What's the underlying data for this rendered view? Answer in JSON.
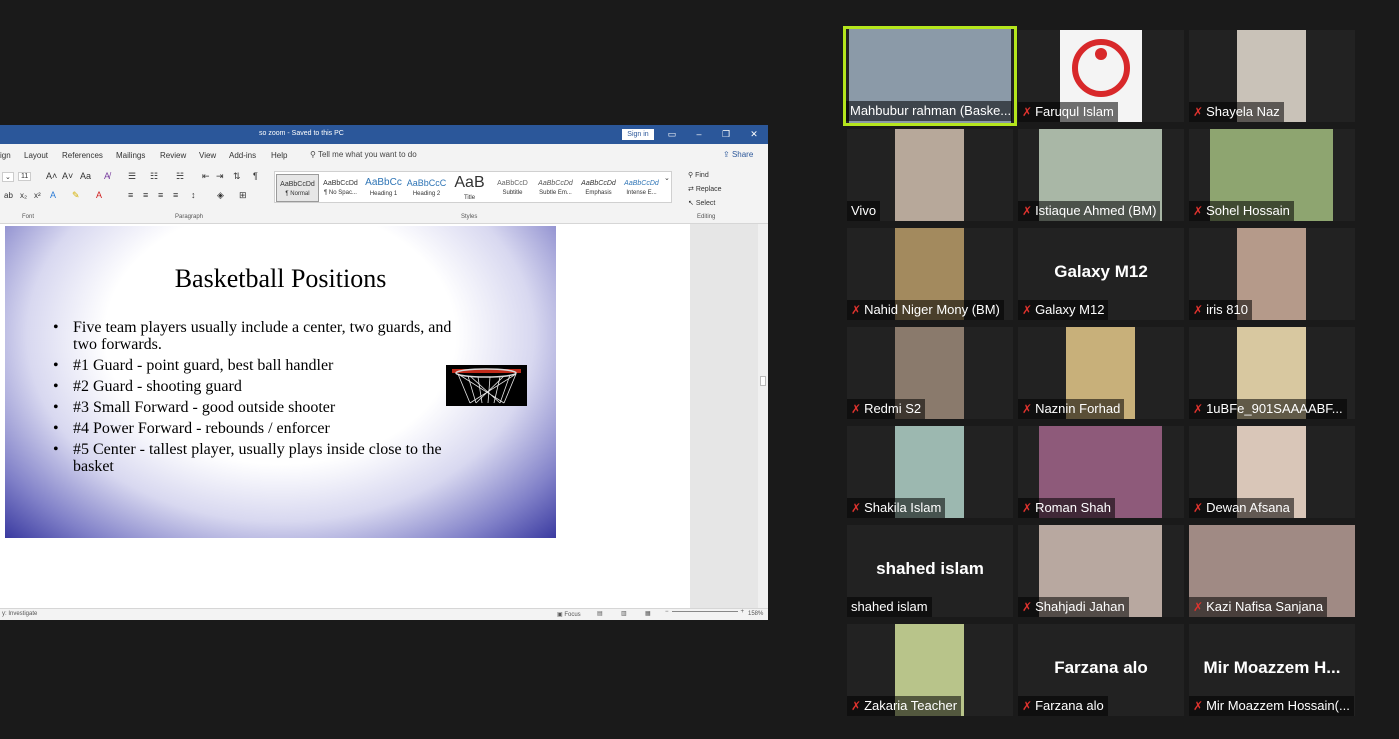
{
  "word": {
    "title": "so zoom - Saved to this PC",
    "signin_label": "Sign in",
    "menu": [
      "ign",
      "Layout",
      "References",
      "Mailings",
      "Review",
      "View",
      "Add-ins",
      "Help"
    ],
    "tell_me": "Tell me what you want to do",
    "share_label": "Share",
    "font_size": "11",
    "group_labels": {
      "font": "Font",
      "paragraph": "Paragraph",
      "styles": "Styles",
      "editing": "Editing"
    },
    "styles": [
      {
        "preview": "AaBbCcDd",
        "name": "¶ Normal"
      },
      {
        "preview": "AaBbCcDd",
        "name": "¶ No Spac..."
      },
      {
        "preview": "AaBbCc",
        "name": "Heading 1"
      },
      {
        "preview": "AaBbCcC",
        "name": "Heading 2"
      },
      {
        "preview": "AaB",
        "name": "Title"
      },
      {
        "preview": "AaBbCcD",
        "name": "Subtitle"
      },
      {
        "preview": "AaBbCcDd",
        "name": "Subtle Em..."
      },
      {
        "preview": "AaBbCcDd",
        "name": "Emphasis"
      },
      {
        "preview": "AaBbCcDd",
        "name": "Intense E..."
      }
    ],
    "editing": {
      "find": "Find",
      "replace": "Replace",
      "select": "Select"
    },
    "status": {
      "left": "y: Investigate",
      "focus": "Focus",
      "zoom": "158%"
    }
  },
  "slide": {
    "title": "Basketball Positions",
    "bullets": [
      "Five team players usually include a center, two guards, and two forwards.",
      "#1 Guard - point guard, best ball handler",
      "#2 Guard - shooting guard",
      "#3 Small Forward - good outside shooter",
      "#4 Power Forward - rebounds / enforcer",
      "#5 Center - tallest player, usually plays inside close to the basket"
    ]
  },
  "participants": [
    {
      "name": "Mahbubur rahman (Baske...",
      "muted": false,
      "video": true,
      "active": true
    },
    {
      "name": "Faruqul Islam",
      "muted": true,
      "video": true
    },
    {
      "name": "Shayela Naz",
      "muted": true,
      "video": true
    },
    {
      "name": "Vivo",
      "muted": false,
      "video": true
    },
    {
      "name": "Istiaque Ahmed (BM)",
      "muted": true,
      "video": true
    },
    {
      "name": "Sohel Hossain",
      "muted": true,
      "video": true
    },
    {
      "name": "Nahid Niger Mony (BM)",
      "muted": true,
      "video": true
    },
    {
      "name": "Galaxy M12",
      "muted": true,
      "video": false,
      "display": "Galaxy M12"
    },
    {
      "name": "iris 810",
      "muted": true,
      "video": true
    },
    {
      "name": "Redmi S2",
      "muted": true,
      "video": true
    },
    {
      "name": "Naznin Forhad",
      "muted": true,
      "video": true
    },
    {
      "name": "1uBFe_901SAAAABF...",
      "muted": true,
      "video": true
    },
    {
      "name": "Shakila Islam",
      "muted": true,
      "video": true
    },
    {
      "name": "Roman Shah",
      "muted": true,
      "video": true
    },
    {
      "name": "Dewan Afsana",
      "muted": true,
      "video": true
    },
    {
      "name": "shahed islam",
      "muted": false,
      "video": false,
      "display": "shahed islam"
    },
    {
      "name": "Shahjadi Jahan",
      "muted": true,
      "video": true
    },
    {
      "name": "Kazi Nafisa Sanjana",
      "muted": true,
      "video": true
    },
    {
      "name": "Zakaria Teacher",
      "muted": true,
      "video": true
    },
    {
      "name": "Farzana alo",
      "muted": true,
      "video": false,
      "display": "Farzana alo"
    },
    {
      "name": "Mir Moazzem Hossain(...",
      "muted": true,
      "video": false,
      "display": "Mir Moazzem H..."
    }
  ]
}
